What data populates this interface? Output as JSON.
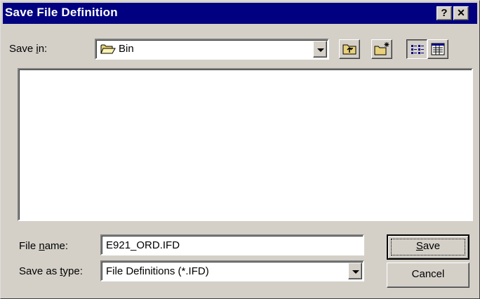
{
  "window": {
    "title": "Save File Definition",
    "help_glyph": "?",
    "close_glyph": "✕"
  },
  "save_in": {
    "label_prefix": "Save ",
    "label_underlined": "i",
    "label_suffix": "n:",
    "selected": "Bin",
    "selected_icon": "folder-icon"
  },
  "toolbar": {
    "buttons": [
      "up-one-level-icon",
      "create-new-folder-icon",
      "list-view-icon",
      "details-view-icon"
    ]
  },
  "file_list": {
    "items": []
  },
  "file_name": {
    "label_prefix": "File ",
    "label_underlined": "n",
    "label_suffix": "ame:",
    "value": "E921_ORD.IFD"
  },
  "save_as_type": {
    "label_prefix": "Save as ",
    "label_underlined": "t",
    "label_suffix": "ype:",
    "selected": "File Definitions (*.IFD)"
  },
  "buttons": {
    "save_underlined": "S",
    "save_rest": "ave",
    "cancel": "Cancel"
  },
  "colors": {
    "titlebar": "#000080",
    "face": "#d4d0c8",
    "window": "#ffffff"
  }
}
